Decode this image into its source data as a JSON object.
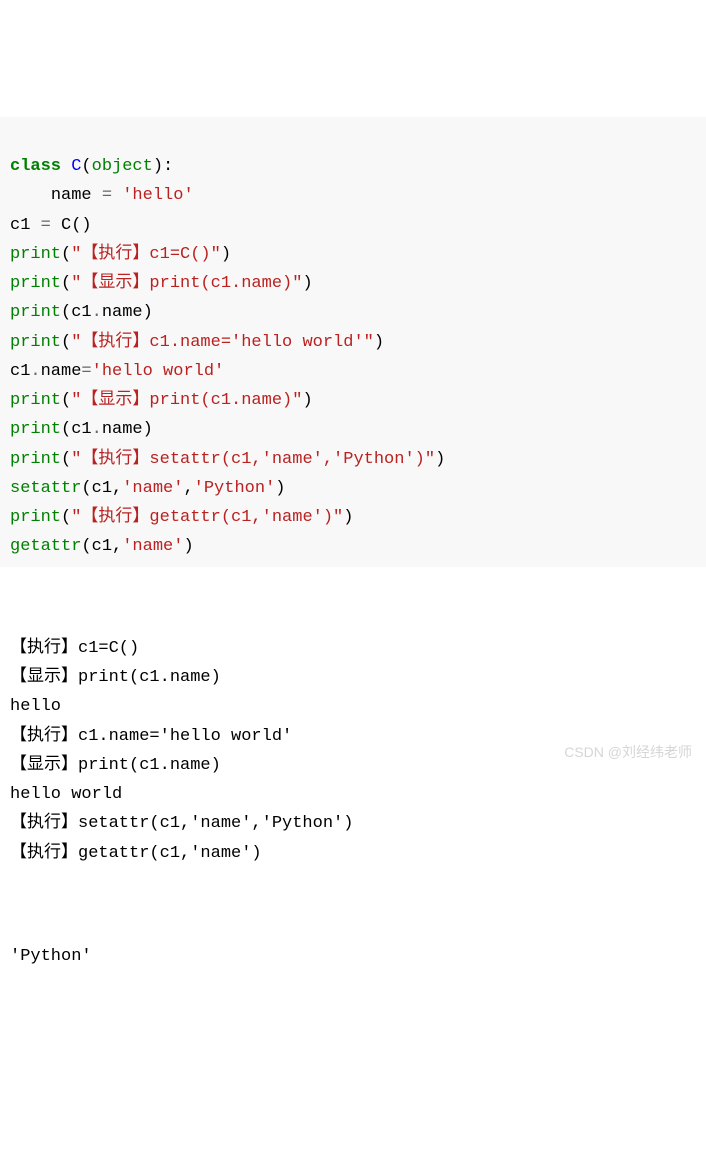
{
  "code": {
    "line1": {
      "kw1": "class",
      "sp1": " ",
      "cls": "C",
      "plain1": "(",
      "fn1": "object",
      "plain2": "):"
    },
    "line2": {
      "indent": "    ",
      "plain1": "name ",
      "op": "=",
      "sp": " ",
      "str": "'hello'"
    },
    "line3": {
      "plain1": "c1 ",
      "op": "=",
      "plain2": " C()"
    },
    "line4": {
      "fn": "print",
      "plain1": "(",
      "str": "\"【执行】c1=C()\"",
      "plain2": ")"
    },
    "line5": {
      "fn": "print",
      "plain1": "(",
      "str": "\"【显示】print(c1.name)\"",
      "plain2": ")"
    },
    "line6": {
      "fn": "print",
      "plain1": "(c1",
      "op": ".",
      "plain2": "name)"
    },
    "line7": {
      "fn": "print",
      "plain1": "(",
      "str": "\"【执行】c1.name='hello world'\"",
      "plain2": ")"
    },
    "line8": {
      "plain1": "c1",
      "op1": ".",
      "plain2": "name",
      "op2": "=",
      "str": "'hello world'"
    },
    "line9": {
      "fn": "print",
      "plain1": "(",
      "str": "\"【显示】print(c1.name)\"",
      "plain2": ")"
    },
    "line10": {
      "fn": "print",
      "plain1": "(c1",
      "op": ".",
      "plain2": "name)"
    },
    "line11": {
      "fn": "print",
      "plain1": "(",
      "str": "\"【执行】setattr(c1,'name','Python')\"",
      "plain2": ")"
    },
    "line12": {
      "fn": "setattr",
      "plain1": "(c1,",
      "str1": "'name'",
      "plain2": ",",
      "str2": "'Python'",
      "plain3": ")"
    },
    "line13": {
      "fn": "print",
      "plain1": "(",
      "str": "\"【执行】getattr(c1,'name')\"",
      "plain2": ")"
    },
    "line14": {
      "fn": "getattr",
      "plain1": "(c1,",
      "str": "'name'",
      "plain2": ")"
    }
  },
  "output": {
    "o1": "【执行】c1=C()",
    "o2": "【显示】print(c1.name)",
    "o3": "hello",
    "o4": "【执行】c1.name='hello world'",
    "o5": "【显示】print(c1.name)",
    "o6": "hello world",
    "o7": "【执行】setattr(c1,'name','Python')",
    "o8": "【执行】getattr(c1,'name')"
  },
  "result": {
    "r1": "'Python'"
  },
  "watermark": "CSDN @刘经纬老师"
}
